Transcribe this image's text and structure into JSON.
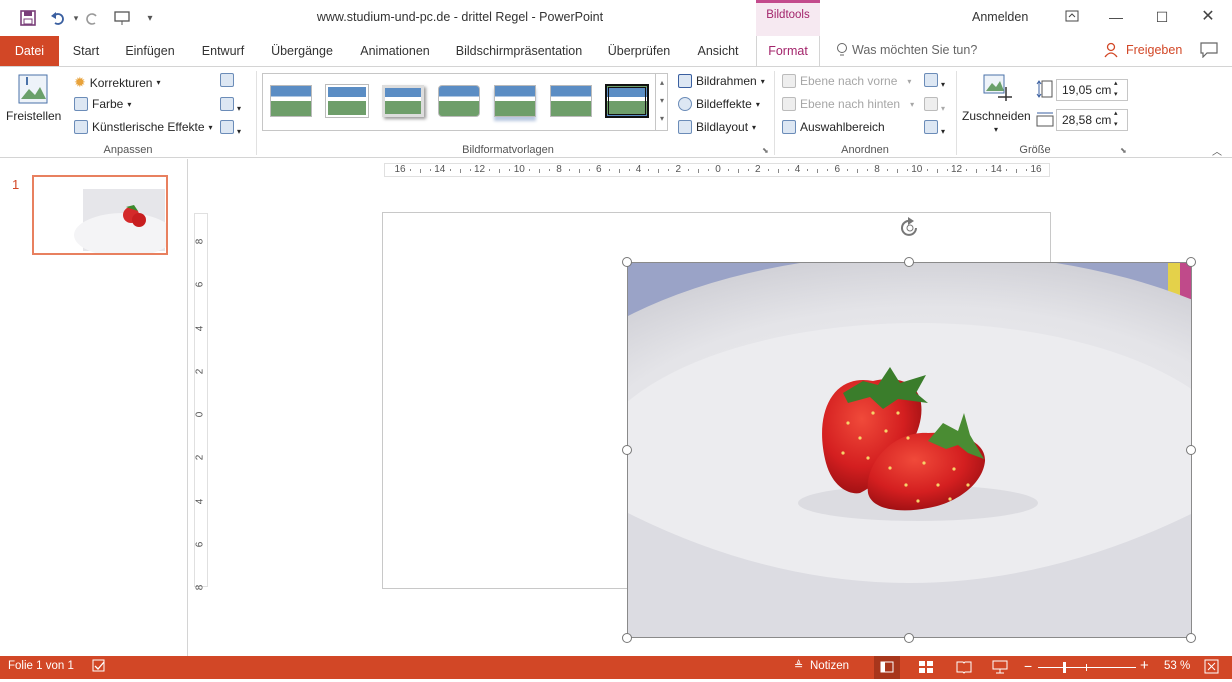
{
  "window": {
    "title": "www.studium-und-pc.de - drittel Regel  -  PowerPoint",
    "contextual_tab_group": "Bildtools",
    "signin": "Anmelden",
    "icons": [
      "save-icon",
      "undo-icon",
      "redo-icon",
      "present-icon",
      "customize-qat-icon",
      "ribbon-display-icon",
      "minimize-icon",
      "maximize-icon",
      "close-icon"
    ]
  },
  "tabs": [
    "Datei",
    "Start",
    "Einfügen",
    "Entwurf",
    "Übergänge",
    "Animationen",
    "Bildschirmpräsentation",
    "Überprüfen",
    "Ansicht",
    "Format"
  ],
  "active_tab": "Format",
  "tellme": "Was möchten Sie tun?",
  "share": "Freigeben",
  "ribbon": {
    "anpassen": {
      "label": "Anpassen",
      "freistellen": "Freistellen",
      "korrekturen": "Korrekturen",
      "farbe": "Farbe",
      "kuenstlerisch": "Künstlerische Effekte"
    },
    "styles": {
      "label": "Bildformatvorlagen",
      "bildrahmen": "Bildrahmen",
      "bildeffekte": "Bildeffekte",
      "bildlayout": "Bildlayout"
    },
    "anordnen": {
      "label": "Anordnen",
      "vorne": "Ebene nach vorne",
      "hinten": "Ebene nach hinten",
      "auswahl": "Auswahlbereich"
    },
    "groesse": {
      "label": "Größe",
      "zuschneiden": "Zuschneiden",
      "height": "19,05 cm",
      "width": "28,58 cm"
    }
  },
  "ruler": {
    "h_ticks": [
      "16",
      "14",
      "12",
      "10",
      "8",
      "6",
      "4",
      "2",
      "0",
      "2",
      "4",
      "6",
      "8",
      "10",
      "12",
      "14",
      "16"
    ],
    "v_ticks": [
      "8",
      "6",
      "4",
      "2",
      "0",
      "2",
      "4",
      "6",
      "8"
    ]
  },
  "slides": {
    "number": "1"
  },
  "status": {
    "slide": "Folie 1 von 1",
    "notes": "Notizen",
    "zoom": "53 %",
    "zoom_level": 0.53
  },
  "colors": {
    "accent": "#d24726",
    "format_tab": "#a3246b"
  }
}
